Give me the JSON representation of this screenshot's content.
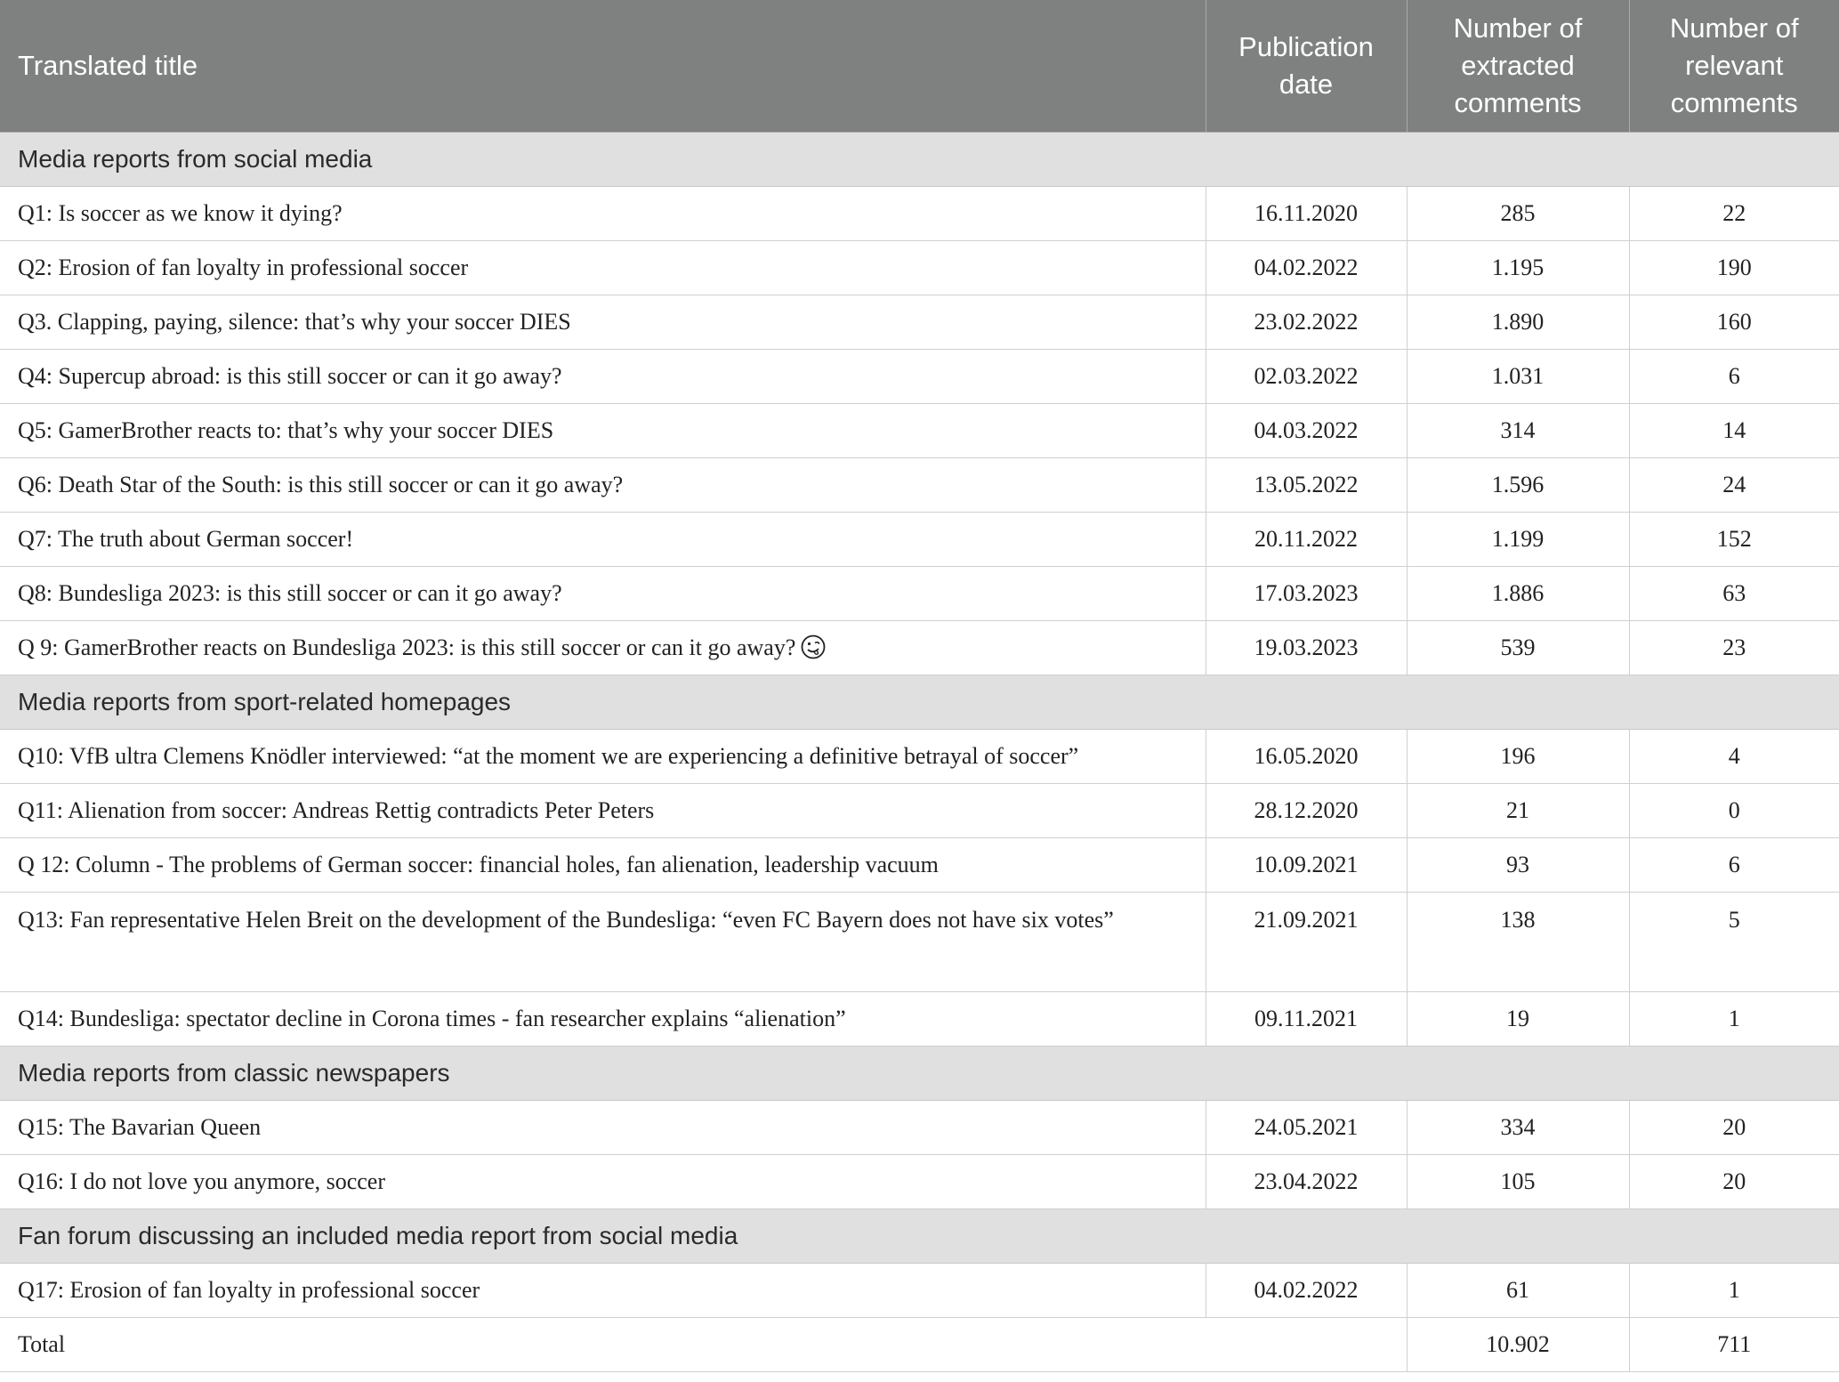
{
  "headers": {
    "title": "Translated title",
    "date": "Publication date",
    "extracted": "Number of extracted comments",
    "relevant": "Number of relevant comments"
  },
  "sections": [
    {
      "label": "Media reports from social media",
      "rows": [
        {
          "title": "Q1: Is soccer as we know it dying?",
          "date": "16.11.2020",
          "extracted": "285",
          "relevant": "22"
        },
        {
          "title": "Q2: Erosion of fan loyalty in professional soccer",
          "date": "04.02.2022",
          "extracted": "1.195",
          "relevant": "190"
        },
        {
          "title": "Q3. Clapping, paying, silence: that’s why your soccer DIES",
          "date": "23.02.2022",
          "extracted": "1.890",
          "relevant": "160"
        },
        {
          "title": "Q4: Supercup abroad: is this still soccer or can it go away?",
          "date": "02.03.2022",
          "extracted": "1.031",
          "relevant": "6"
        },
        {
          "title": "Q5: GamerBrother reacts to: that’s why your soccer DIES",
          "date": "04.03.2022",
          "extracted": "314",
          "relevant": "14"
        },
        {
          "title": "Q6: Death Star of the South: is this still soccer or can it go away?",
          "date": "13.05.2022",
          "extracted": "1.596",
          "relevant": "24"
        },
        {
          "title": "Q7: The truth about German soccer!",
          "date": "20.11.2022",
          "extracted": "1.199",
          "relevant": "152"
        },
        {
          "title": "Q8: Bundesliga 2023: is this still soccer or can it go away?",
          "date": "17.03.2023",
          "extracted": "1.886",
          "relevant": "63"
        },
        {
          "title": "Q 9: GamerBrother reacts on Bundesliga 2023: is this still soccer or can it go away?",
          "date": "19.03.2023",
          "extracted": "539",
          "relevant": "23"
        }
      ]
    },
    {
      "label": "Media reports from sport-related homepages",
      "rows": [
        {
          "title": "Q10: VfB ultra Clemens Knödler interviewed: “at the moment we are experiencing a definitive betrayal of soccer”",
          "date": "16.05.2020",
          "extracted": "196",
          "relevant": "4"
        },
        {
          "title": "Q11: Alienation from soccer: Andreas Rettig contradicts Peter Peters",
          "date": "28.12.2020",
          "extracted": "21",
          "relevant": "0"
        },
        {
          "title": "Q 12: Column - The problems of German soccer: financial holes, fan alienation, leadership vacuum",
          "date": "10.09.2021",
          "extracted": "93",
          "relevant": "6"
        },
        {
          "title": "Q13: Fan representative Helen Breit on the development of the Bundesliga: “even FC Bayern does not have six votes”",
          "date": "21.09.2021",
          "extracted": "138",
          "relevant": "5"
        },
        {
          "title": "Q14: Bundesliga: spectator decline in Corona times - fan researcher explains “alienation”",
          "date": "09.11.2021",
          "extracted": "19",
          "relevant": "1"
        }
      ]
    },
    {
      "label": "Media reports from classic newspapers",
      "rows": [
        {
          "title": "Q15: The Bavarian Queen",
          "date": "24.05.2021",
          "extracted": "334",
          "relevant": "20"
        },
        {
          "title": "Q16: I do not love you anymore, soccer",
          "date": "23.04.2022",
          "extracted": "105",
          "relevant": "20"
        }
      ]
    },
    {
      "label": "Fan forum discussing an included media report from social media",
      "rows": [
        {
          "title": "Q17: Erosion of fan loyalty in professional soccer",
          "date": "04.02.2022",
          "extracted": "61",
          "relevant": "1"
        }
      ]
    }
  ],
  "total": {
    "label": "Total",
    "extracted": "10.902",
    "relevant": "711"
  },
  "icons": {
    "q9_emoji": "zany-face-emoji"
  }
}
